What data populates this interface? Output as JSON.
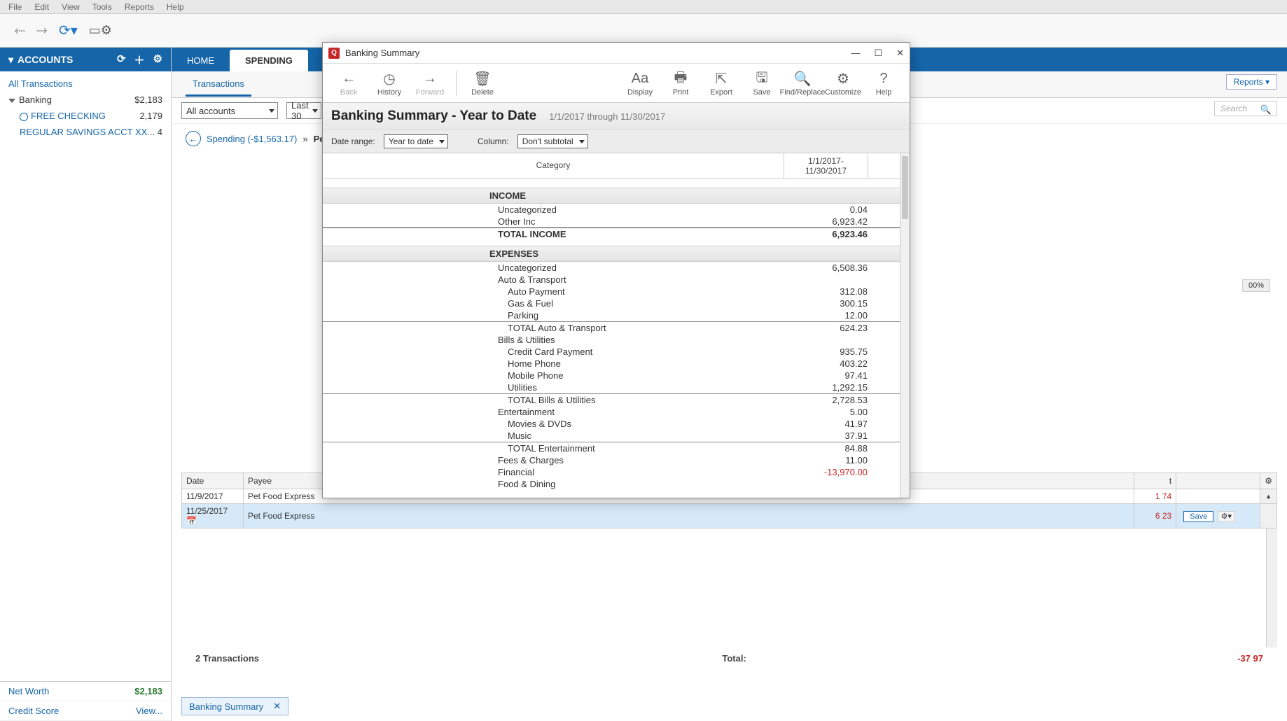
{
  "menubar": [
    "File",
    "Edit",
    "View",
    "Tools",
    "Reports",
    "Help"
  ],
  "sidebar": {
    "title": "ACCOUNTS",
    "all_tx": "All Transactions",
    "groups": [
      {
        "label": "Banking",
        "amount": "$2,183"
      }
    ],
    "accounts": [
      {
        "label": "FREE CHECKING",
        "amount": "2,179"
      },
      {
        "label": "REGULAR SAVINGS ACCT XX...",
        "amount": "4"
      }
    ],
    "footer": [
      {
        "label": "Net Worth",
        "value": "$2,183",
        "cls": "green"
      },
      {
        "label": "Credit Score",
        "value": "View...",
        "cls": ""
      }
    ]
  },
  "tabs": [
    {
      "label": "HOME",
      "active": false
    },
    {
      "label": "SPENDING",
      "active": true
    }
  ],
  "subtabs": {
    "label": "Transactions"
  },
  "reports_btn": "Reports ▾",
  "filters": {
    "accounts": "All accounts",
    "period": "Last 30",
    "search_ph": "Search"
  },
  "breadcrumb": {
    "spending": "Spending (-$1,563.17)",
    "sep": "»",
    "current": "Pets ("
  },
  "percent_badge": "00%",
  "tx_table": {
    "headers": [
      "Date",
      "Payee"
    ],
    "rows": [
      {
        "date": "11/9/2017",
        "payee": "Pet Food Express",
        "right": "1 74"
      },
      {
        "date": "11/25/2017",
        "payee": "Pet Food Express",
        "right": "6 23",
        "selected": true
      }
    ],
    "right_col_hdr": "t",
    "save": "Save",
    "count": "2 Transactions",
    "total_lbl": "Total:",
    "total_val": "-37 97"
  },
  "status_tab": {
    "label": "Banking Summary",
    "close": "✕"
  },
  "popup": {
    "title": "Banking Summary",
    "toolbar": [
      {
        "ico": "←",
        "label": "Back",
        "cls": "dis"
      },
      {
        "ico": "◷",
        "label": "History",
        "cls": ""
      },
      {
        "ico": "→",
        "label": "Forward",
        "cls": "dis"
      },
      {
        "sep": true
      },
      {
        "ico": "🗑",
        "label": "Delete",
        "cls": ""
      }
    ],
    "toolbar_right": [
      {
        "ico": "Aa",
        "label": "Display"
      },
      {
        "ico": "🖶",
        "label": "Print"
      },
      {
        "ico": "⇱",
        "label": "Export"
      },
      {
        "ico": "🖫",
        "label": "Save"
      },
      {
        "ico": "🔍",
        "label": "Find/Replace"
      },
      {
        "ico": "⚙",
        "label": "Customize"
      },
      {
        "ico": "?",
        "label": "Help"
      }
    ],
    "report_title": "Banking Summary - Year to Date",
    "date_range_text": "1/1/2017 through 11/30/2017",
    "opt_date_lbl": "Date range:",
    "opt_date_val": "Year to date",
    "opt_col_lbl": "Column:",
    "opt_col_val": "Don't subtotal",
    "col_headers": {
      "cat": "Category",
      "period": "1/1/2017- 11/30/2017"
    },
    "sections": [
      {
        "name": "INCOME",
        "rows": [
          {
            "l": "Uncategorized",
            "v": "0.04"
          },
          {
            "l": "Other Inc",
            "v": "6,923.42"
          }
        ],
        "total": {
          "l": "TOTAL INCOME",
          "v": "6,923.46"
        }
      },
      {
        "name": "EXPENSES",
        "rows": [
          {
            "l": "Uncategorized",
            "v": "6,508.36"
          },
          {
            "l": "Auto & Transport",
            "v": ""
          },
          {
            "l": "Auto Payment",
            "v": "312.08",
            "ind": 1
          },
          {
            "l": "Gas & Fuel",
            "v": "300.15",
            "ind": 1
          },
          {
            "l": "Parking",
            "v": "12.00",
            "ind": 1
          },
          {
            "l": "TOTAL Auto & Transport",
            "v": "624.23",
            "ind": 1,
            "subtot": true
          },
          {
            "l": "Bills & Utilities",
            "v": ""
          },
          {
            "l": "Credit Card Payment",
            "v": "935.75",
            "ind": 1
          },
          {
            "l": "Home Phone",
            "v": "403.22",
            "ind": 1
          },
          {
            "l": "Mobile Phone",
            "v": "97.41",
            "ind": 1
          },
          {
            "l": "Utilities",
            "v": "1,292.15",
            "ind": 1
          },
          {
            "l": "TOTAL Bills & Utilities",
            "v": "2,728.53",
            "ind": 1,
            "subtot": true
          },
          {
            "l": "Entertainment",
            "v": "5.00"
          },
          {
            "l": "Movies & DVDs",
            "v": "41.97",
            "ind": 1
          },
          {
            "l": "Music",
            "v": "37.91",
            "ind": 1
          },
          {
            "l": "TOTAL Entertainment",
            "v": "84.88",
            "ind": 1,
            "subtot": true
          },
          {
            "l": "Fees & Charges",
            "v": "11.00"
          },
          {
            "l": "Financial",
            "v": "-13,970.00",
            "neg": true
          },
          {
            "l": "Food & Dining",
            "v": ""
          }
        ]
      }
    ]
  }
}
